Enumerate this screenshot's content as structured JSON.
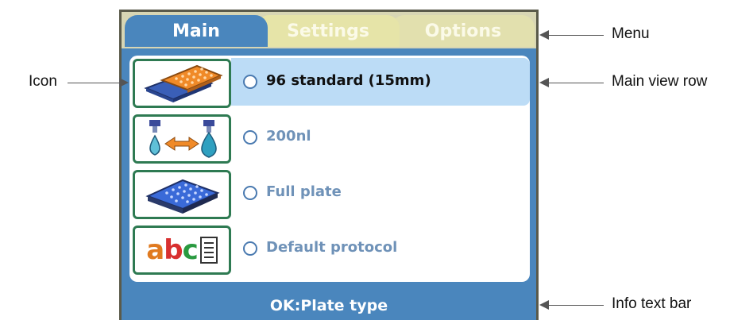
{
  "tabs": [
    {
      "label": "Main",
      "active": true
    },
    {
      "label": "Settings",
      "active": false
    },
    {
      "label": "Options",
      "active": false
    }
  ],
  "rows": [
    {
      "icon": "plate-stack-icon",
      "label": "96 standard (15mm)",
      "selected": true
    },
    {
      "icon": "dispense-volume-icon",
      "label": "200nl",
      "selected": false
    },
    {
      "icon": "full-plate-icon",
      "label": "Full plate",
      "selected": false
    },
    {
      "icon": "protocol-abc-icon",
      "label": "Default protocol",
      "selected": false
    }
  ],
  "info_bar": "OK:Plate type",
  "annotations": {
    "menu": "Menu",
    "icon": "Icon",
    "main_view_row": "Main view row",
    "info_text_bar": "Info text bar"
  },
  "colors": {
    "frame_blue": "#4a86bd",
    "selected_row": "#bcdcf6",
    "icon_border": "#2e7a52",
    "inactive_tab": "#e6e4a8",
    "label_blue": "#6f92b8"
  }
}
